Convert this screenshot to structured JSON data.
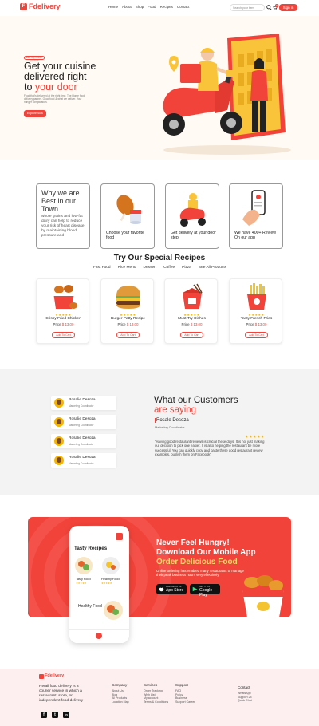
{
  "header": {
    "logo_text": "Fdelivery",
    "nav": [
      "Home",
      "About",
      "Shop",
      "Food",
      "Recipes",
      "Contact"
    ],
    "search_placeholder": "Search your item",
    "cart_badge": "0",
    "signin_label": "Sign in"
  },
  "hero": {
    "badge": "Easy way to order your food",
    "title_line1": "Get your cuisine",
    "title_line2": "delivered right",
    "title_line3_prefix": "to ",
    "title_line3_highlight": "your door",
    "description": "Food that's delivered at the right time. The Home food delivery partner. Good food & what we deliver. Your hunger complication.",
    "cta": "Explore Now"
  },
  "features": [
    {
      "title": "Why we are Best in our Town",
      "text": "whole grains and low-fat dairy can help to reduce your risk of heart disease by maintaining blood pressure and"
    },
    {
      "title": "",
      "text": "Choose your favorite food"
    },
    {
      "title": "",
      "text": "Get delivery at your door step"
    },
    {
      "title": "",
      "text": "We have 400+ Review On our app"
    }
  ],
  "recipes": {
    "title": "Try Our Special Recipes",
    "tabs": [
      "Fast Food",
      "Rice Menu",
      "Dessert",
      "Coffee",
      "Pizza",
      "See All Products"
    ],
    "items": [
      {
        "name": "Crispy Fried Chicken",
        "price_label": "Price",
        "price": "$ 13.00",
        "button": "Add To Cart",
        "stars": "★★★★★"
      },
      {
        "name": "Burger Patty Recipe",
        "price_label": "Price",
        "price": "$ 13.00",
        "button": "Add To Cart",
        "stars": "★★★★★"
      },
      {
        "name": "Must-Try Dishes",
        "price_label": "Price",
        "price": "$ 13.00",
        "button": "Add To Cart",
        "stars": "★★★★★"
      },
      {
        "name": "Tasty French Fries",
        "price_label": "Price",
        "price": "$ 13.00",
        "button": "Add To Cart",
        "stars": "★★★★★"
      }
    ]
  },
  "testimonials": {
    "people": [
      {
        "name": "Rosalie Desoza",
        "role": "Marketing Coordinator"
      },
      {
        "name": "Rosalie Desoza",
        "role": "Marketing Coordinator"
      },
      {
        "name": "Rosalie Desoza",
        "role": "Marketing Coordinator"
      },
      {
        "name": "Rosalie Desoza",
        "role": "Marketing Coordinator"
      }
    ],
    "title_line1": "What our Customers",
    "title_line2": "are saying",
    "active_name": "Rosale Desoza",
    "active_role": "Marketing Coordinator",
    "stars": "★★★★★",
    "quote": "\"Having good restaurant reviews is crucial these days. It is not just making our decision to pick one easier. It is also helping the restaurant be more successful. You can quickly copy and paste these good restaurant review examples, publish them on Facebook\""
  },
  "promo": {
    "phone_title": "Tasty Recipes",
    "phone_item1": "Tasty Food",
    "phone_item2": "Healthy Food",
    "phone_big": "Healthy Food",
    "line1": "Never Feel Hungry!",
    "line2": "Download Our Mobile App",
    "line3": "Order Delicious Food",
    "description": "Online ordering has enabled many restaurants to manage their peak business hours very effectively",
    "appstore_small": "Download on the",
    "appstore": "App Store",
    "play_small": "GET IT ON",
    "play": "Google Play"
  },
  "footer": {
    "logo_text": "Fdelivery",
    "description": "Retail food delivery is a courier service in which a restaurant, store, or independent food-delivery",
    "columns": [
      {
        "heading": "Company",
        "links": [
          "About Us",
          "Blog",
          "All Products",
          "Location Map"
        ]
      },
      {
        "heading": "Services",
        "links": [
          "Order Tracking",
          "Wish List",
          "My account",
          "Terms & Conditions"
        ]
      },
      {
        "heading": "Support",
        "links": [
          "FAQ",
          "Policy",
          "Business",
          "Support Career"
        ]
      },
      {
        "heading": "Contact",
        "links": [
          "WhatsApp",
          "Support 24",
          "Quick Chat"
        ]
      }
    ],
    "social": [
      "f",
      "t",
      "in"
    ]
  },
  "colors": {
    "accent": "#f2433a",
    "star": "#f4b400",
    "footer_bg": "#fdeff0"
  }
}
